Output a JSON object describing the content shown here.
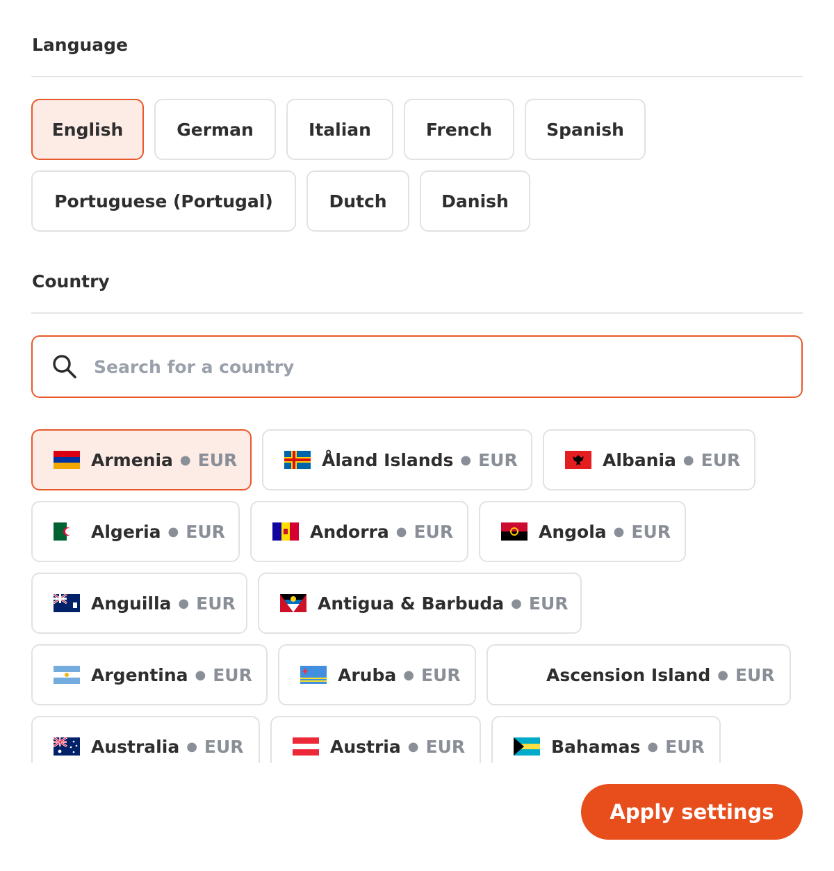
{
  "language": {
    "title": "Language",
    "options": [
      "English",
      "German",
      "Italian",
      "French",
      "Spanish",
      "Portuguese (Portugal)",
      "Dutch",
      "Danish"
    ],
    "selected": "English"
  },
  "country": {
    "title": "Country",
    "search_placeholder": "Search for a country",
    "items": [
      {
        "name": "Armenia",
        "currency": "EUR",
        "flag": "flag-armenia-icon"
      },
      {
        "name": "Åland Islands",
        "currency": "EUR",
        "flag": "flag-aland-icon"
      },
      {
        "name": "Albania",
        "currency": "EUR",
        "flag": "flag-albania-icon"
      },
      {
        "name": "Algeria",
        "currency": "EUR",
        "flag": "flag-algeria-icon"
      },
      {
        "name": "Andorra",
        "currency": "EUR",
        "flag": "flag-andorra-icon"
      },
      {
        "name": "Angola",
        "currency": "EUR",
        "flag": "flag-angola-icon"
      },
      {
        "name": "Anguilla",
        "currency": "EUR",
        "flag": "flag-anguilla-icon"
      },
      {
        "name": "Antigua & Barbuda",
        "currency": "EUR",
        "flag": "flag-antigua-icon"
      },
      {
        "name": "Argentina",
        "currency": "EUR",
        "flag": "flag-argentina-icon"
      },
      {
        "name": "Aruba",
        "currency": "EUR",
        "flag": "flag-aruba-icon"
      },
      {
        "name": "Ascension Island",
        "currency": "EUR",
        "flag": ""
      },
      {
        "name": "Australia",
        "currency": "EUR",
        "flag": "flag-australia-icon"
      },
      {
        "name": "Austria",
        "currency": "EUR",
        "flag": "flag-austria-icon"
      },
      {
        "name": "Bahamas",
        "currency": "EUR",
        "flag": "flag-bahamas-icon"
      }
    ],
    "selected": "Armenia"
  },
  "apply_label": "Apply settings",
  "colors": {
    "accent": "#e84e1b",
    "selected_bg": "#fdebe6",
    "border": "#e2e2e2"
  }
}
